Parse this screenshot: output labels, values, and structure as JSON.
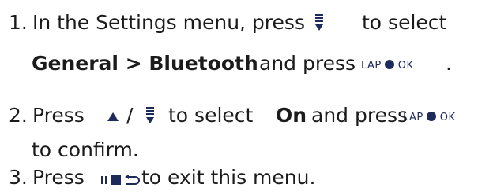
{
  "steps": [
    {
      "number": "1.",
      "text_a": "In the Settings menu, press",
      "text_b": "to select",
      "bold_path": "General > Bluetooth",
      "text_c": "and press",
      "text_end": "."
    },
    {
      "number": "2.",
      "text_a": "Press",
      "slash": "/",
      "text_b": "to select",
      "bold_option": "On",
      "text_c": "and press",
      "text_d": "to confirm."
    },
    {
      "number": "3.",
      "text_a": "Press",
      "text_b": "to exit this menu."
    }
  ],
  "lap_ok_button": {
    "label_left": "LAP",
    "label_right": "OK"
  },
  "icons": {
    "menu": "menu-down-icon",
    "up": "up-triangle-icon",
    "lap_ok": "lap-ok-button-icon",
    "back": "pause-stop-back-icon"
  },
  "colors": {
    "text": "#1b1b1b",
    "icon": "#1e2a5c"
  }
}
